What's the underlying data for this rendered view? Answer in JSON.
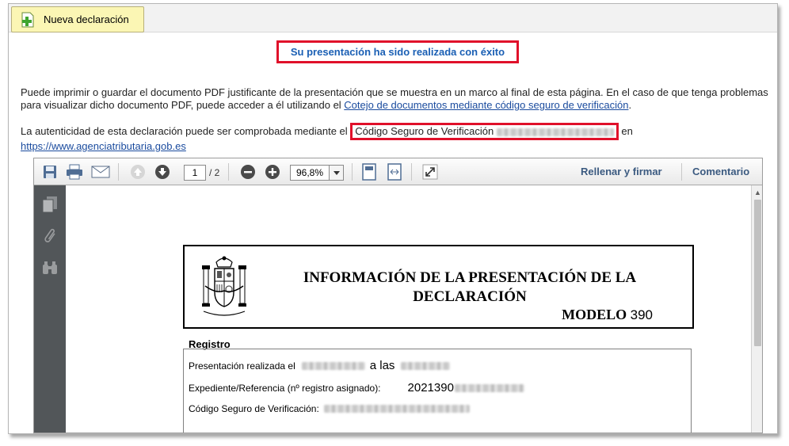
{
  "toolbar": {
    "new_declaration_label": "Nueva declaración"
  },
  "success_message": "Su presentación ha sido realizada con éxito",
  "intro": {
    "text": "Puede imprimir o guardar el documento PDF justificante de la presentación que se muestra en un marco al final de esta página. En el caso de que tenga problemas para visualizar dicho documento PDF, puede acceder a él utilizando el ",
    "link": "Cotejo de documentos mediante código seguro de verificación",
    "end": "."
  },
  "authenticity": {
    "text": "La autenticidad de esta declaración puede ser comprobada mediante el ",
    "csv_label": "Código Seguro de Verificación",
    "after": " en",
    "url": "https://www.agenciatributaria.gob.es"
  },
  "viewer": {
    "current_page": "1",
    "total_pages": "/ 2",
    "zoom": "96,8%",
    "fill_sign": "Rellenar y firmar",
    "comment": "Comentario"
  },
  "document": {
    "title_line1": "INFORMACIÓN DE LA PRESENTACIÓN DE LA",
    "title_line2": "DECLARACIÓN",
    "modelo_label": "MODELO",
    "modelo_number": "390",
    "registro_title": "Registro",
    "presentacion_label": "Presentación realizada el",
    "a_las": "a las",
    "expediente_label": "Expediente/Referencia (nº registro asignado):",
    "expediente_value": "2021390",
    "csv_row_label": "Código Seguro de Verificación:"
  },
  "colors": {
    "highlight_border": "#e0102a",
    "link": "#1a4b9e",
    "success_text": "#1a5fb4",
    "button_bg": "#fbf6b4"
  },
  "icons": [
    "add-document-icon",
    "save-icon",
    "print-icon",
    "email-icon",
    "previous-page-icon",
    "next-page-icon",
    "zoom-out-icon",
    "zoom-in-icon",
    "dropdown-arrow-icon",
    "fit-page-icon",
    "fit-width-icon",
    "fullscreen-icon",
    "pages-icon",
    "attachment-icon",
    "binoculars-icon",
    "spain-coat-of-arms-icon"
  ]
}
